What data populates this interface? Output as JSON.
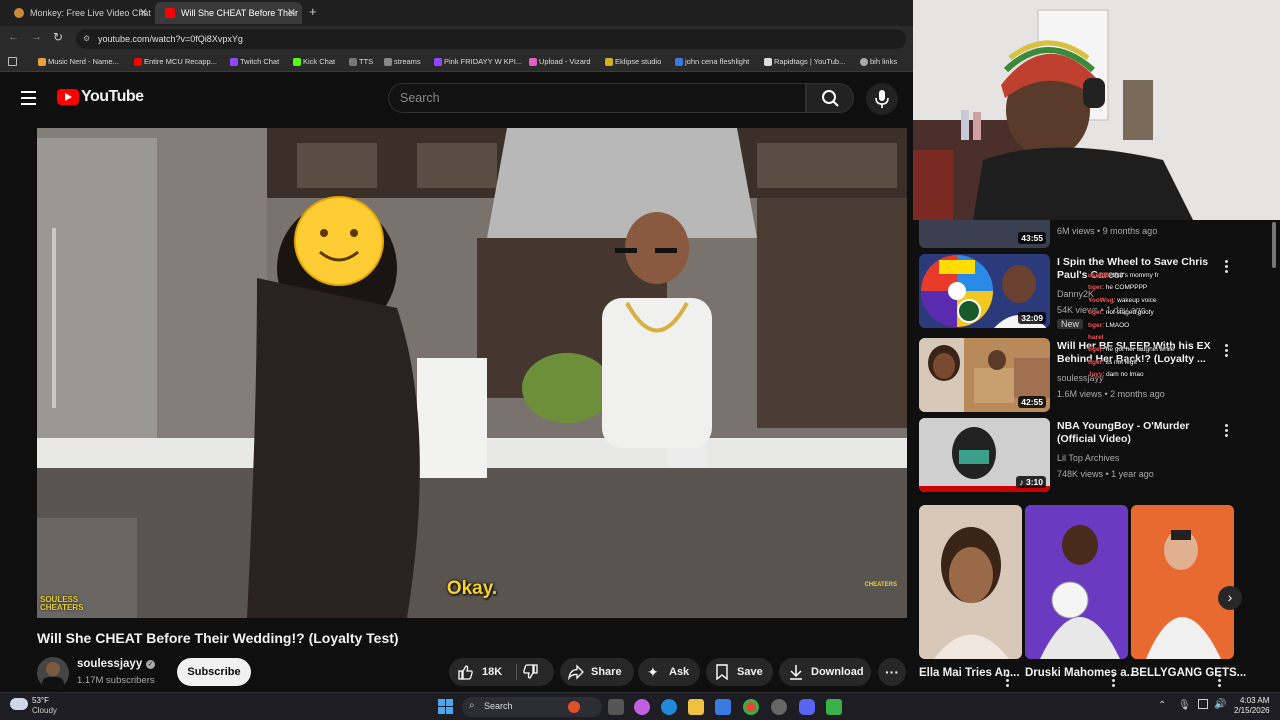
{
  "browser": {
    "tabs": [
      {
        "title": "Monkey: Free Live Video Chat",
        "active": false
      },
      {
        "title": "Will She CHEAT Before Their",
        "active": true
      }
    ],
    "url": "youtube.com/watch?v=0fQi8XvpxYg",
    "bookmarks": [
      "Music Nerd - Name...",
      "Entire MCU Recapp...",
      "Twitch Chat",
      "Kick Chat",
      "TTS",
      "streams",
      "Pink FRIDAYY W KPI...",
      "Upload - Vizard",
      "Eklipse studio",
      "john cena fleshlight",
      "Rapidtags | YouTub...",
      "bih links"
    ]
  },
  "youtube": {
    "logo_text": "YouTube",
    "search_placeholder": "Search"
  },
  "video": {
    "subtitle": "Okay.",
    "watermark_left": "SOULESS CHEATERS",
    "watermark_right": "CHEATERS",
    "title": "Will She CHEAT Before Their Wedding!? (Loyalty Test)",
    "channel": "soulessjayy",
    "subscribers": "1.17M subscribers",
    "subscribe_label": "Subscribe",
    "likes": "18K",
    "share_label": "Share",
    "ask_label": "Ask",
    "save_label": "Save",
    "download_label": "Download"
  },
  "recommendations": [
    {
      "title": "",
      "duration": "43:55",
      "channel": "",
      "meta": "6M views • 9 months ago"
    },
    {
      "title": "I Spin the Wheel to Save Chris Paul's Career",
      "duration": "32:09",
      "channel": "Danny2K",
      "meta": "54K views • 1 day ago",
      "badge": "New"
    },
    {
      "title": "Will Her BF SLEEP With his EX Behind Her Back!? (Loyalty ...",
      "duration": "42:55",
      "channel": "soulessjayy",
      "meta": "1.6M views • 2 months ago"
    },
    {
      "title": "NBA YoungBoy - O'Murder (Official Video)",
      "duration": "3:10",
      "channel": "Lil Top Archives",
      "meta": "748K views • 1 year ago"
    }
  ],
  "shorts": [
    {
      "title": "Ella Mai Tries An..."
    },
    {
      "title": "Druski Mahomes a..."
    },
    {
      "title": "BELLYGANG GETS..."
    }
  ],
  "overlay_chat": [
    {
      "user": "user88",
      "msg": ": that's mommy fr"
    },
    {
      "user": "tiger",
      "msg": ": he COMPPPP"
    },
    {
      "user": "YooWsg",
      "msg": ": wakeup voice"
    },
    {
      "user": "tiger",
      "msg": ": not staged goofy"
    },
    {
      "user": "tiger",
      "msg": ": LMAOO"
    },
    {
      "user": "harel",
      "msg": ""
    },
    {
      "user": "tiger",
      "msg": ": he got her laughin while"
    },
    {
      "user": "tiger",
      "msg": ": its not legit"
    },
    {
      "user": "Jayy",
      "msg": ": dam no lmao"
    }
  ],
  "taskbar": {
    "weather_temp": "53°F",
    "weather_desc": "Cloudy",
    "search_label": "Search",
    "time": "4:03 AM",
    "date": "2/15/2026"
  },
  "colors": {
    "yt_red": "#ff0000",
    "bg": "#0f0f0f",
    "surface": "#272727"
  }
}
